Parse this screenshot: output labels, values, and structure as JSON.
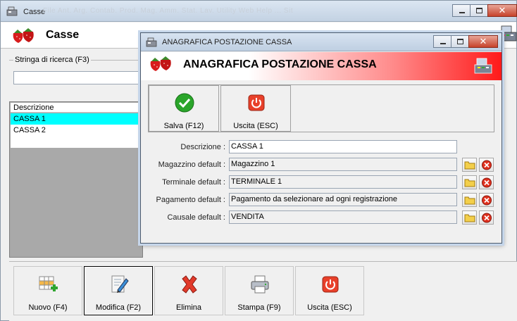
{
  "main_window": {
    "title": "Casse",
    "ghost_menu": "File   Ant.   Arg.   Contab.   Prod.   Mag.   Amm.   Stat.   Lav.   Utility   Web   Help   ...   Sit",
    "header_title": "Casse",
    "search": {
      "legend": "Stringa di ricerca (F3)",
      "value": ""
    },
    "list": {
      "column_header": "Descrizione",
      "rows": [
        "CASSA 1",
        "CASSA 2"
      ],
      "selected_row": "CASSA 1"
    },
    "toolbar": {
      "new_label": "Nuovo (F4)",
      "edit_label": "Modifica (F2)",
      "delete_label": "Elimina",
      "print_label": "Stampa (F9)",
      "exit_label": "Uscita (ESC)"
    }
  },
  "dialog": {
    "title": "ANAGRAFICA POSTAZIONE CASSA",
    "header_title": "ANAGRAFICA POSTAZIONE CASSA",
    "toolbar": {
      "save_label": "Salva (F12)",
      "exit_label": "Uscita (ESC)"
    },
    "fields": {
      "descrizione": {
        "label": "Descrizione :",
        "value": "CASSA 1"
      },
      "magazzino": {
        "label": "Magazzino default :",
        "value": "Magazzino 1"
      },
      "terminale": {
        "label": "Terminale default :",
        "value": "TERMINALE 1"
      },
      "pagamento": {
        "label": "Pagamento default :",
        "value": "Pagamento da selezionare ad ogni registrazione"
      },
      "causale": {
        "label": "Causale default :",
        "value": "VENDITA"
      }
    }
  },
  "colors": {
    "selected_row": "#00ffff",
    "header_gradient_end": "#ff1a1a",
    "save_green": "#2aa52a",
    "exit_red": "#e8402a"
  },
  "icons": [
    "app-icon",
    "strawberry-icon",
    "cash-register-icon",
    "checkmark-icon",
    "power-icon",
    "grid-add-icon",
    "edit-document-icon",
    "delete-x-icon",
    "printer-icon",
    "folder-icon",
    "clear-x-icon"
  ]
}
